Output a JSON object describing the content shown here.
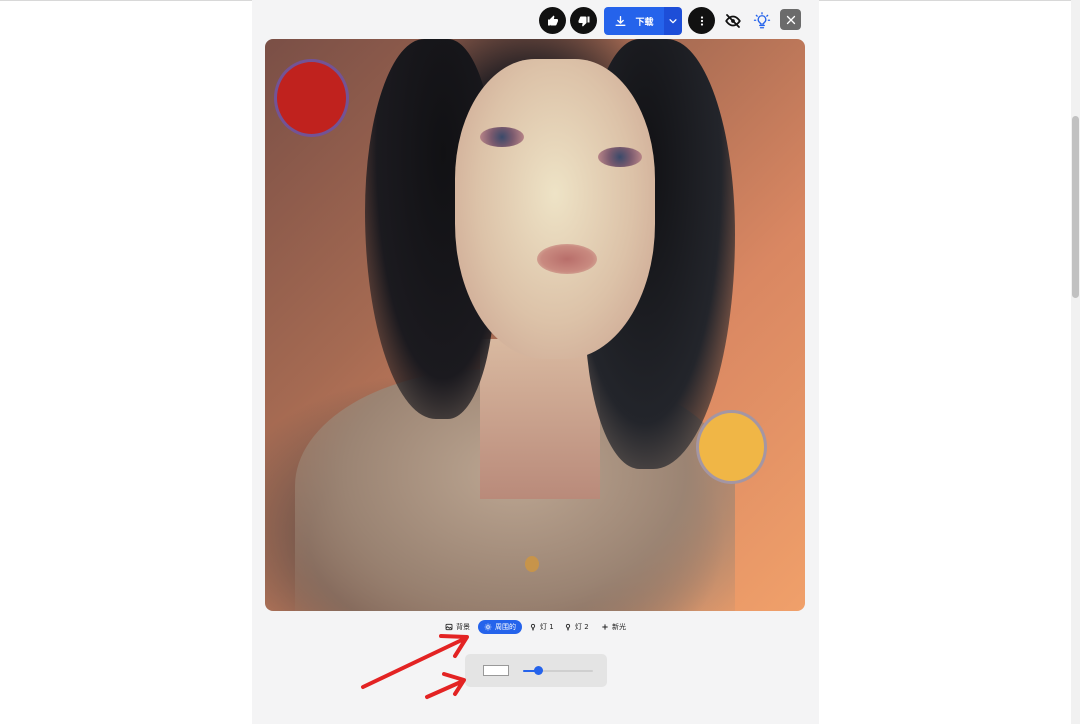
{
  "toolbar": {
    "download_label": "下载",
    "icons": [
      "thumbs-up-icon",
      "thumbs-down-icon",
      "download-icon",
      "chevron-down-icon",
      "more-vertical-icon",
      "eye-off-icon",
      "lightbulb-icon",
      "close-icon"
    ]
  },
  "tabs": [
    {
      "label": "背景",
      "icon": "image-icon",
      "active": false
    },
    {
      "label": "周围的",
      "icon": "sun-icon",
      "active": true
    },
    {
      "label": "灯 1",
      "icon": "bulb-icon",
      "active": false
    },
    {
      "label": "灯 2",
      "icon": "bulb-icon",
      "active": false
    },
    {
      "label": "新光",
      "icon": "plus-icon",
      "active": false
    }
  ],
  "ambient": {
    "color": "#ffffff",
    "intensity": 0.22
  },
  "lights": [
    {
      "name": "light-1",
      "color": "#c0221e"
    },
    {
      "name": "light-2",
      "color": "#f0b646"
    }
  ],
  "colors": {
    "accent": "#2563eb",
    "annotation": "#e32323"
  }
}
